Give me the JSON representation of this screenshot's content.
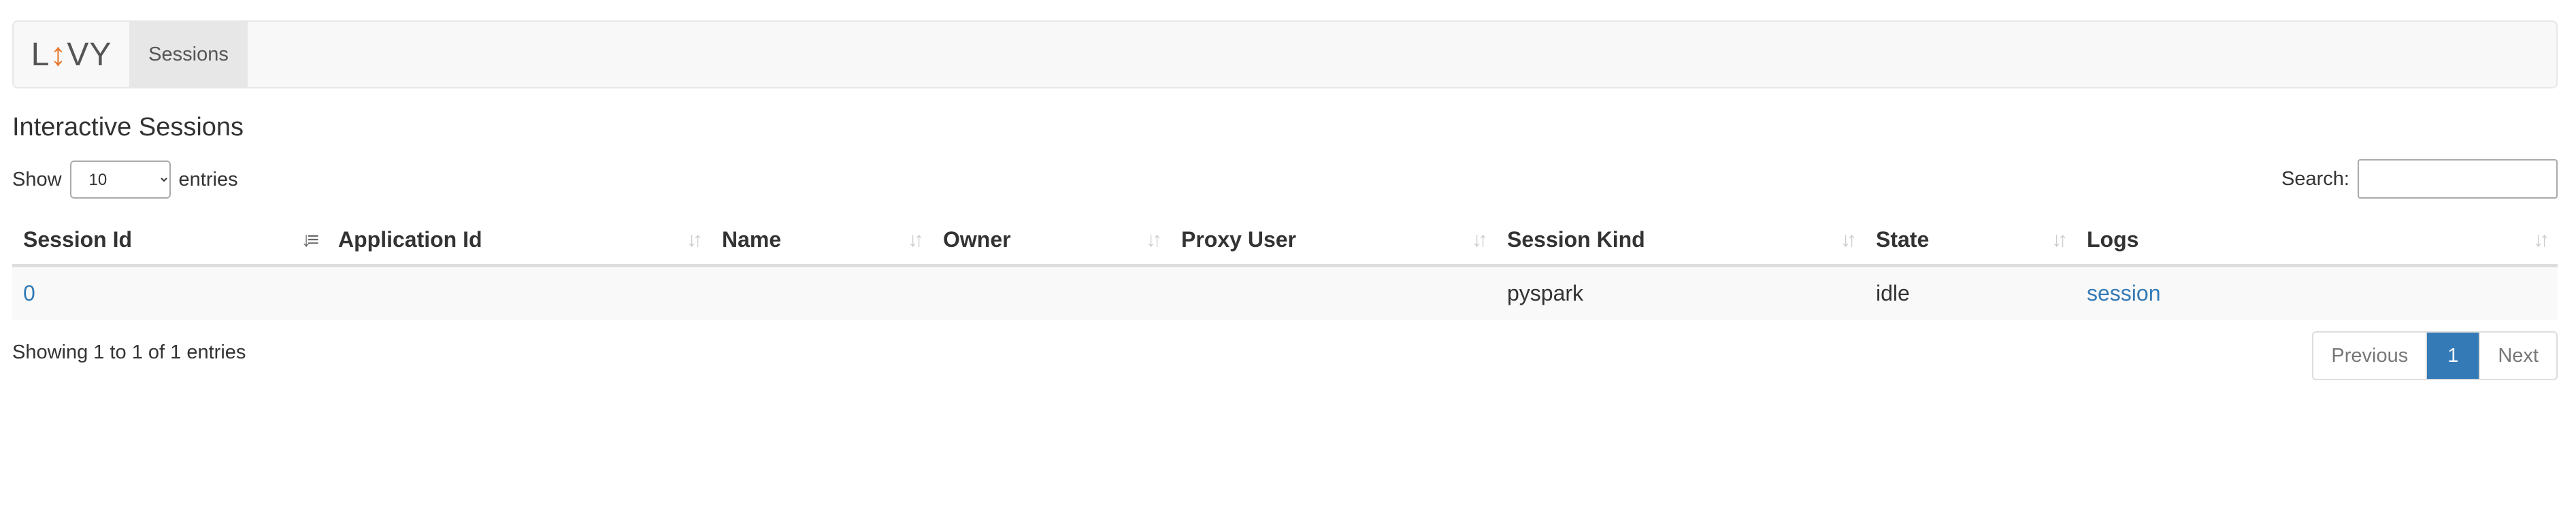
{
  "navbar": {
    "brand": {
      "left": "L",
      "arrow": "↕",
      "right": "VY"
    },
    "tabs": [
      {
        "label": "Sessions"
      }
    ]
  },
  "page_title": "Interactive Sessions",
  "length_menu": {
    "show_label": "Show",
    "selected": "10",
    "entries_label": "entries"
  },
  "search": {
    "label": "Search:",
    "value": ""
  },
  "table": {
    "columns": [
      {
        "label": "Session Id",
        "sort": "ascending"
      },
      {
        "label": "Application Id",
        "sort": "none"
      },
      {
        "label": "Name",
        "sort": "none"
      },
      {
        "label": "Owner",
        "sort": "none"
      },
      {
        "label": "Proxy User",
        "sort": "none"
      },
      {
        "label": "Session Kind",
        "sort": "none"
      },
      {
        "label": "State",
        "sort": "none"
      },
      {
        "label": "Logs",
        "sort": "none"
      }
    ],
    "rows": [
      {
        "session_id": "0",
        "application_id": "",
        "name": "",
        "owner": "",
        "proxy_user": "",
        "session_kind": "pyspark",
        "state": "idle",
        "logs": "session"
      }
    ]
  },
  "info": "Showing 1 to 1 of 1 entries",
  "pagination": {
    "previous": "Previous",
    "current": "1",
    "next": "Next"
  },
  "colors": {
    "link": "#337ab7",
    "brand_accent": "#e8772e",
    "active_page": "#337ab7"
  },
  "icons": {
    "sort_active": "sort-amount-asc-icon",
    "sort_inactive": "sort-both-icon"
  }
}
